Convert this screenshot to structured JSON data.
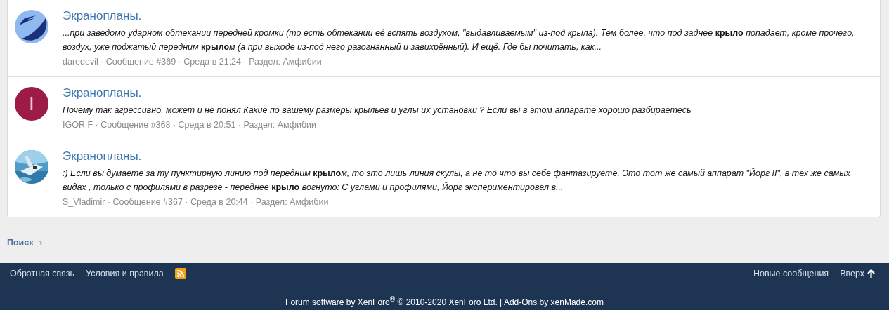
{
  "results": [
    {
      "avatar": {
        "kind": "logo"
      },
      "title": "Экранопланы.",
      "snippet": "...при заведомо ударном обтекании передней кромки (то есть обтекании её вспять воздухом, \"выдавливаемым\" из-под крыла). Тем более, что под заднее **крыло** попадает, кроме прочего, воздух, уже поджатый передним **крыло**м (а при выходе из-под него разогнанный и завихрённый). И ещё. Где бы почитать, как...",
      "author": "daredevil",
      "meta": "· Сообщение #369 · Среда в 21:24 · Раздел: Амфибии"
    },
    {
      "avatar": {
        "kind": "letter",
        "letter": "I",
        "color": "#9c1c47"
      },
      "title": "Экранопланы.",
      "snippet": "Почему так агрессивно, может и не понял Какие по вашему размеры крыльев и углы их установки ? Если вы в этом аппарате хорошо разбираетесь",
      "author": "IGOR F",
      "meta": "· Сообщение #368 · Среда в 20:51 · Раздел: Амфибии"
    },
    {
      "title": "Экранопланы.",
      "snippet": ":) Если вы думаете за ту пунктирную линию под передним **крыло**м, то это лишь линия скулы, а не то что вы себе фантазируете. Это тот же самый аппарат \"Йорг II\", в тех же самых видах , только с профилями в разрезе - переднее **крыло** вогнуто: С углами и профилями, Йорг экспериментировал в...",
      "author": "S_Vladimir",
      "meta": "· Сообщение #367 · Среда в 20:44 · Раздел: Амфибии"
    }
  ],
  "search_link": {
    "label": "Поиск",
    "chevron": "›"
  },
  "footer": {
    "left_links": [
      "Обратная связь",
      "Условия и правила"
    ],
    "right_links": [
      {
        "label": "Новые сообщения",
        "kind": "text"
      },
      {
        "label": "Вверх",
        "kind": "top"
      }
    ],
    "copyright": "Forum software by XenForo$^{®}$ © 2010-2020 XenForo Ltd. | Add-Ons by xenMade.com"
  }
}
